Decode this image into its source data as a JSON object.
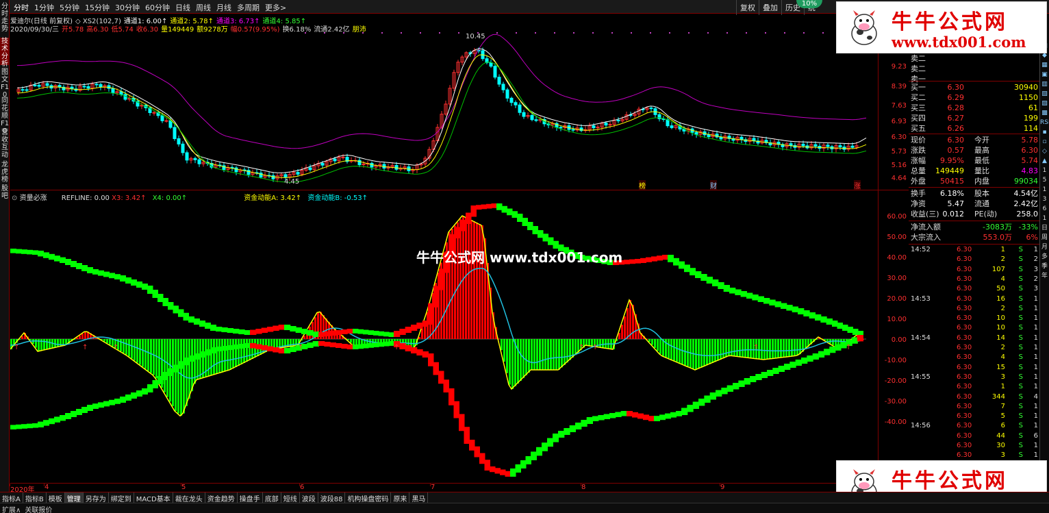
{
  "top_menu": [
    "分时",
    "1分钟",
    "5分钟",
    "15分钟",
    "30分钟",
    "60分钟",
    "日线",
    "周线",
    "月线",
    "多周期",
    "更多>"
  ],
  "top_right_buttons": [
    "复权",
    "叠加",
    "历史",
    "统"
  ],
  "percent_badge": "10%",
  "left_tabs": [
    "分时走势",
    "技术分析",
    "图文F10",
    "同花顺F10",
    "营收互动",
    "龙虎榜",
    "股吧"
  ],
  "kline": {
    "line1": "爱迪尔(日线 前复权) ◇ XS2(102,7) 通道1: 6.00↑ 通道2: 5.78↑ 通道3: 6.73↑ 通道4: 5.85↑",
    "line1_parts": [
      {
        "t": "爱迪尔(日线 前复权)",
        "c": "#ddd"
      },
      {
        "t": "◇ XS2(102,7)",
        "c": "#ddd"
      },
      {
        "t": "通道1: 6.00↑",
        "c": "#fff"
      },
      {
        "t": "通道2: 5.78↑",
        "c": "#ff0"
      },
      {
        "t": "通道3: 6.73↑",
        "c": "#f0f"
      },
      {
        "t": "通道4: 5.85↑",
        "c": "#3f3"
      }
    ],
    "line2_parts": [
      {
        "t": "2020/09/30/三",
        "c": "#ddd"
      },
      {
        "t": "开5.78",
        "c": "#ff3030"
      },
      {
        "t": "高6.30",
        "c": "#ff3030"
      },
      {
        "t": "低5.74",
        "c": "#ff3030"
      },
      {
        "t": "收6.30",
        "c": "#ff3030"
      },
      {
        "t": "量149449",
        "c": "#ff0"
      },
      {
        "t": "额9278万",
        "c": "#ff0"
      },
      {
        "t": "幅0.57(9.95%)",
        "c": "#ff3030"
      },
      {
        "t": "换6.18%",
        "c": "#ddd"
      },
      {
        "t": "流通2.42亿",
        "c": "#ddd"
      },
      {
        "t": "朋沛",
        "c": "#ff0"
      }
    ],
    "high_label": "10.45",
    "low_label": "4.45",
    "price_axis": [
      "9.23",
      "8.39",
      "7.63",
      "6.93",
      "6.30",
      "5.73",
      "5.16",
      "4.64"
    ],
    "markers": [
      {
        "t": "榜",
        "c": "#ff0"
      },
      {
        "t": "财",
        "c": "#8cf"
      },
      {
        "t": "涨",
        "c": "#ff3030"
      }
    ]
  },
  "indicator": {
    "title": "资量必涨",
    "refline": "REFLINE: 0.00",
    "x3": "X3: 3.42↑",
    "x4": "X4: 0.00↑",
    "a": "资金动能A: 3.42↑",
    "b": "资金动能B: -0.53↑",
    "axis": [
      "60.00",
      "50.00",
      "40.00",
      "30.00",
      "20.00",
      "10.00",
      "0.00",
      "-10.00",
      "-20.00",
      "-30.00",
      "-40.00"
    ]
  },
  "dates": [
    "2020年",
    "4",
    "5",
    "6",
    "7",
    "8",
    "9"
  ],
  "watermark_center": "牛牛公式网 www.tdx001.com",
  "banner": {
    "title": "牛牛公式网",
    "url": "www.tdx001.com"
  },
  "quote": {
    "sells": [
      {
        "l": "卖二"
      },
      {
        "l": "卖二"
      },
      {
        "l": "卖一"
      }
    ],
    "buys": [
      {
        "l": "买一",
        "p": "6.30",
        "v": "30940"
      },
      {
        "l": "买二",
        "p": "6.29",
        "v": "1150"
      },
      {
        "l": "买三",
        "p": "6.28",
        "v": "61"
      },
      {
        "l": "买四",
        "p": "6.27",
        "v": "199"
      },
      {
        "l": "买五",
        "p": "6.26",
        "v": "114"
      }
    ],
    "stats": [
      {
        "a": "现价",
        "b": "6.30",
        "bc": "red",
        "c": "今开",
        "d": "5.78",
        "dc": "red"
      },
      {
        "a": "涨跌",
        "b": "0.57",
        "bc": "red",
        "c": "最高",
        "d": "6.30",
        "dc": "red"
      },
      {
        "a": "涨幅",
        "b": "9.95%",
        "bc": "red",
        "c": "最低",
        "d": "5.74",
        "dc": "red"
      },
      {
        "a": "总量",
        "b": "149449",
        "bc": "yel",
        "c": "量比",
        "d": "4.83",
        "dc": "mag"
      },
      {
        "a": "外盘",
        "b": "50415",
        "bc": "red",
        "c": "内盘",
        "d": "99034",
        "dc": "grn"
      }
    ],
    "stats2": [
      {
        "a": "换手",
        "b": "6.18%",
        "c": "股本",
        "d": "4.54亿"
      },
      {
        "a": "净资",
        "b": "5.47",
        "c": "流通",
        "d": "2.42亿"
      },
      {
        "a": "收益(三)",
        "b": "0.012",
        "c": "PE(动)",
        "d": "258.0"
      }
    ],
    "flow": [
      {
        "a": "净流入额",
        "b": "-3083万",
        "c": "-33%"
      },
      {
        "a": "大宗流入",
        "b": "553.0万",
        "c": "6%"
      }
    ],
    "ticks": [
      {
        "t": "14:52",
        "p": "6.30",
        "v": "1",
        "s": "S",
        "n": "1"
      },
      {
        "t": "",
        "p": "6.30",
        "v": "2",
        "s": "S",
        "n": "2"
      },
      {
        "t": "",
        "p": "6.30",
        "v": "107",
        "s": "S",
        "n": "3"
      },
      {
        "t": "",
        "p": "6.30",
        "v": "4",
        "s": "S",
        "n": "2"
      },
      {
        "t": "",
        "p": "6.30",
        "v": "50",
        "s": "S",
        "n": "3"
      },
      {
        "t": "14:53",
        "p": "6.30",
        "v": "16",
        "s": "S",
        "n": "1"
      },
      {
        "t": "",
        "p": "6.30",
        "v": "2",
        "s": "S",
        "n": "1"
      },
      {
        "t": "",
        "p": "6.30",
        "v": "10",
        "s": "S",
        "n": "1"
      },
      {
        "t": "",
        "p": "6.30",
        "v": "10",
        "s": "S",
        "n": "1"
      },
      {
        "t": "14:54",
        "p": "6.30",
        "v": "14",
        "s": "S",
        "n": "1"
      },
      {
        "t": "",
        "p": "6.30",
        "v": "2",
        "s": "S",
        "n": "1"
      },
      {
        "t": "",
        "p": "6.30",
        "v": "4",
        "s": "S",
        "n": "1"
      },
      {
        "t": "",
        "p": "6.30",
        "v": "15",
        "s": "S",
        "n": "1"
      },
      {
        "t": "14:55",
        "p": "6.30",
        "v": "3",
        "s": "S",
        "n": "1"
      },
      {
        "t": "",
        "p": "6.30",
        "v": "1",
        "s": "S",
        "n": "1"
      },
      {
        "t": "",
        "p": "6.30",
        "v": "344",
        "s": "S",
        "n": "4"
      },
      {
        "t": "",
        "p": "6.30",
        "v": "7",
        "s": "S",
        "n": "1"
      },
      {
        "t": "",
        "p": "6.30",
        "v": "5",
        "s": "S",
        "n": "1"
      },
      {
        "t": "14:56",
        "p": "6.30",
        "v": "6",
        "s": "S",
        "n": "1"
      },
      {
        "t": "",
        "p": "6.30",
        "v": "44",
        "s": "S",
        "n": "6"
      },
      {
        "t": "",
        "p": "6.30",
        "v": "30",
        "s": "S",
        "n": "1"
      },
      {
        "t": "",
        "p": "6.30",
        "v": "3",
        "s": "S",
        "n": "1"
      }
    ]
  },
  "right_icons": [
    "×",
    "▲",
    "▤",
    "◆",
    "▦",
    "▣",
    "▥",
    "▧",
    "▨",
    "▩",
    "RSI",
    "▪",
    "▫",
    "◇",
    "▲",
    "1",
    "5",
    "1",
    "3",
    "6",
    "1",
    "日",
    "周",
    "月",
    "多",
    "季",
    "年"
  ],
  "bottom_tabs": [
    "指标A",
    "指标B",
    "模板",
    "管理",
    "另存为",
    "绑定到",
    "MACD基本",
    "裁在龙头",
    "资金趋势",
    "操盘手",
    "底部",
    "短线",
    "波段",
    "波段88",
    "机构操盘密码",
    "原来",
    "黑马"
  ],
  "status": [
    "扩展∧",
    "关联报价"
  ],
  "colors": {
    "up": "#ff3030",
    "down": "#00ffff",
    "bar_red": "#ff0000",
    "bar_green": "#00ff00",
    "yellow": "#ffff00",
    "cyan_line": "#20c0e0",
    "frame": "#800000"
  }
}
